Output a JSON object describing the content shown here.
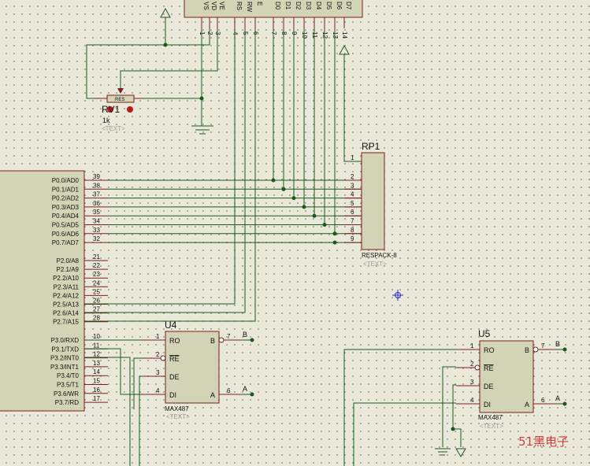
{
  "lcd": {
    "pin_labels": [
      "VS",
      "VD",
      "VE",
      "RS",
      "RW",
      "E",
      "D0",
      "D1",
      "D2",
      "D3",
      "D4",
      "D5",
      "D6",
      "D7"
    ],
    "pin_numbers": [
      "1",
      "2",
      "3",
      "4",
      "5",
      "6",
      "7",
      "8",
      "9",
      "10",
      "11",
      "12",
      "13",
      "14"
    ]
  },
  "pot": {
    "ref": "RV1",
    "value": "1k",
    "text_placeholder": "<TEXT>",
    "body_label": "RES"
  },
  "mcu": {
    "port0": [
      {
        "label": "P0.0/AD0",
        "pin": "39"
      },
      {
        "label": "P0.1/AD1",
        "pin": "38"
      },
      {
        "label": "P0.2/AD2",
        "pin": "37"
      },
      {
        "label": "P0.3/AD3",
        "pin": "36"
      },
      {
        "label": "P0.4/AD4",
        "pin": "35"
      },
      {
        "label": "P0.5/AD5",
        "pin": "34"
      },
      {
        "label": "P0.6/AD6",
        "pin": "33"
      },
      {
        "label": "P0.7/AD7",
        "pin": "32"
      }
    ],
    "port2": [
      {
        "label": "P2.0/A8",
        "pin": "21"
      },
      {
        "label": "P2.1/A9",
        "pin": "22"
      },
      {
        "label": "P2.2/A10",
        "pin": "23"
      },
      {
        "label": "P2.3/A11",
        "pin": "24"
      },
      {
        "label": "P2.4/A12",
        "pin": "25"
      },
      {
        "label": "P2.5/A13",
        "pin": "26"
      },
      {
        "label": "P2.6/A14",
        "pin": "27"
      },
      {
        "label": "P2.7/A15",
        "pin": "28"
      }
    ],
    "port3": [
      {
        "label": "P3.0/RXD",
        "pin": "10"
      },
      {
        "label": "P3.1/TXD",
        "pin": "11"
      },
      {
        "label": "P3.2/INT0",
        "pin": "12"
      },
      {
        "label": "P3.3/INT1",
        "pin": "13"
      },
      {
        "label": "P3.4/T0",
        "pin": "14"
      },
      {
        "label": "P3.5/T1",
        "pin": "15"
      },
      {
        "label": "P3.6/WR",
        "pin": "16"
      },
      {
        "label": "P3.7/RD",
        "pin": "17"
      }
    ]
  },
  "rp1": {
    "ref": "RP1",
    "part": "RESPACK-8",
    "text_placeholder": "<TEXT>",
    "pins": [
      "1",
      "2",
      "3",
      "4",
      "5",
      "6",
      "7",
      "8",
      "9"
    ]
  },
  "u4": {
    "ref": "U4",
    "part": "MAX487",
    "text_placeholder": "<TEXT>",
    "left_pins": [
      {
        "label": "RO",
        "pin": "1"
      },
      {
        "label": "RE",
        "pin": "2"
      },
      {
        "label": "DE",
        "pin": "3"
      },
      {
        "label": "DI",
        "pin": "4"
      }
    ],
    "right_pins": [
      {
        "label": "B",
        "pin": "7",
        "net": "B"
      },
      {
        "label": "A",
        "pin": "6",
        "net": "A"
      }
    ]
  },
  "u5": {
    "ref": "U5",
    "part": "MAX487",
    "text_placeholder": "<TEXT>",
    "left_pins": [
      {
        "label": "RO",
        "pin": "1"
      },
      {
        "label": "RE",
        "pin": "2"
      },
      {
        "label": "DE",
        "pin": "3"
      },
      {
        "label": "DI",
        "pin": "4"
      }
    ],
    "right_pins": [
      {
        "label": "B",
        "pin": "7",
        "net": "B"
      },
      {
        "label": "A",
        "pin": "6",
        "net": "A"
      }
    ]
  },
  "watermark": "51黑电子",
  "colors": {
    "wire": "#1c5a1c",
    "component_outline": "#7a1f1f",
    "component_fill": "#d3d3b6",
    "background": "#eae8d8",
    "watermark": "#d73a3a",
    "cursor": "#2a2ad0"
  }
}
